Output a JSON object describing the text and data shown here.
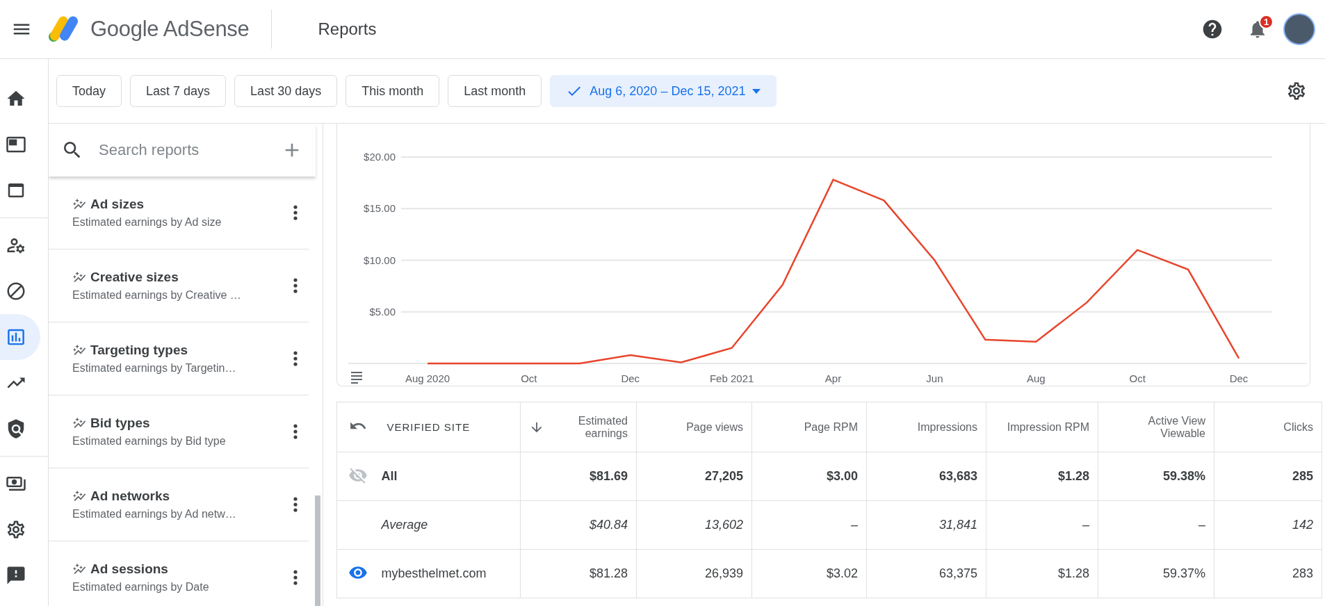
{
  "app": {
    "product": "Google AdSense",
    "page": "Reports",
    "notification_count": "1"
  },
  "nav": [
    {
      "selected": false
    },
    {
      "selected": false
    },
    {
      "selected": false
    },
    {
      "selected": false
    },
    {
      "selected": false
    },
    {
      "selected": true
    },
    {
      "selected": false
    },
    {
      "selected": false
    },
    {
      "selected": false
    },
    {
      "selected": false
    },
    {
      "selected": false
    }
  ],
  "date_filters": [
    {
      "label": "Today",
      "selected": false
    },
    {
      "label": "Last 7 days",
      "selected": false
    },
    {
      "label": "Last 30 days",
      "selected": false
    },
    {
      "label": "This month",
      "selected": false
    },
    {
      "label": "Last month",
      "selected": false
    },
    {
      "label": "Aug 6, 2020 – Dec 15, 2021",
      "selected": true
    }
  ],
  "report_search": {
    "placeholder": "Search reports"
  },
  "reports": [
    {
      "title": "Ad sizes",
      "subtitle": "Estimated earnings by Ad size"
    },
    {
      "title": "Creative sizes",
      "subtitle": "Estimated earnings by Creative …"
    },
    {
      "title": "Targeting types",
      "subtitle": "Estimated earnings by Targetin…"
    },
    {
      "title": "Bid types",
      "subtitle": "Estimated earnings by Bid type"
    },
    {
      "title": "Ad networks",
      "subtitle": "Estimated earnings by Ad netw…"
    },
    {
      "title": "Ad sessions",
      "subtitle": "Estimated earnings by Date"
    }
  ],
  "chart": {
    "chart_data": {
      "type": "line",
      "grid": true,
      "categories": [
        "Aug 2020",
        null,
        "Oct",
        null,
        "Dec",
        null,
        "Feb 2021",
        null,
        "Apr",
        null,
        "Jun",
        null,
        "Aug",
        null,
        "Oct",
        null,
        "Dec"
      ],
      "series": [
        {
          "color": "#e8452c",
          "values": [
            0,
            0,
            0,
            0,
            0.8,
            0.1,
            1.5,
            7.6,
            17.8,
            15.8,
            10,
            2.3,
            2.1,
            5.9,
            11,
            9.1,
            0.5
          ]
        }
      ],
      "ylim": [
        0,
        20
      ],
      "yticks": [
        {
          "value": 5,
          "label": "$5.00"
        },
        {
          "value": 10,
          "label": "$10.00"
        },
        {
          "value": 15,
          "label": "$15.00"
        },
        {
          "value": 20,
          "label": "$20.00"
        }
      ]
    }
  },
  "table": {
    "columns": [
      {
        "label": "VERIFIED SITE",
        "sorted": false
      },
      {
        "label": "Estimated earnings",
        "sorted": true
      },
      {
        "label": "Page views",
        "sorted": false
      },
      {
        "label": "Page RPM",
        "sorted": false
      },
      {
        "label": "Impressions",
        "sorted": false
      },
      {
        "label": "Impression RPM",
        "sorted": false
      },
      {
        "label": "Active View Viewable",
        "sorted": false
      },
      {
        "label": "Clicks",
        "sorted": false
      }
    ],
    "rows": [
      {
        "kind": "total",
        "visible": false,
        "cells": [
          "All",
          "$81.69",
          "27,205",
          "$3.00",
          "63,683",
          "$1.28",
          "59.38%",
          "285"
        ]
      },
      {
        "kind": "average",
        "cells": [
          "Average",
          "$40.84",
          "13,602",
          "–",
          "31,841",
          "–",
          "–",
          "142"
        ]
      },
      {
        "kind": "site",
        "visible": true,
        "cells": [
          "mybesthelmet.com",
          "$81.28",
          "26,939",
          "$3.02",
          "63,375",
          "$1.28",
          "59.37%",
          "283"
        ]
      }
    ]
  }
}
